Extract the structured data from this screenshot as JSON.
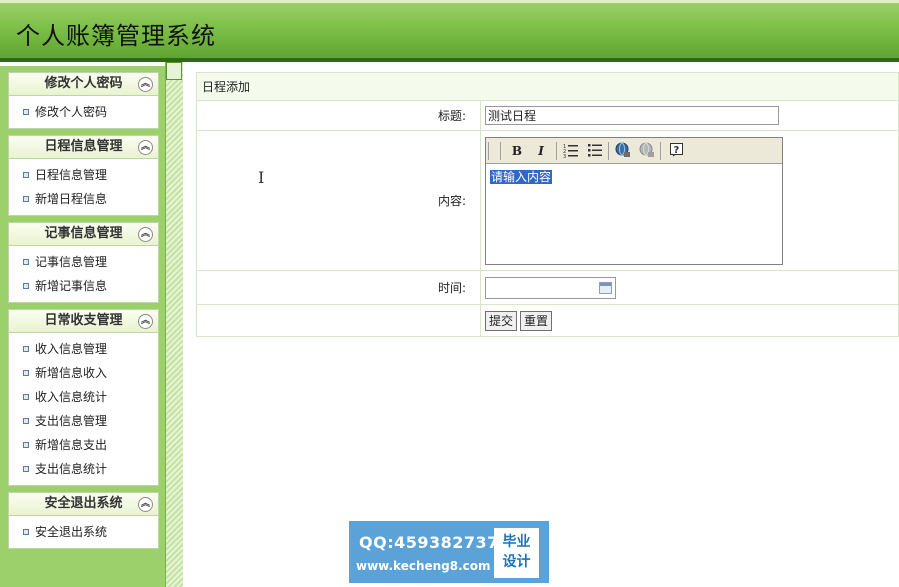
{
  "header": {
    "title": "个人账簿管理系统"
  },
  "sidebar": {
    "groups": [
      {
        "title": "修改个人密码",
        "items": [
          "修改个人密码"
        ]
      },
      {
        "title": "日程信息管理",
        "items": [
          "日程信息管理",
          "新增日程信息"
        ]
      },
      {
        "title": "记事信息管理",
        "items": [
          "记事信息管理",
          "新增记事信息"
        ]
      },
      {
        "title": "日常收支管理",
        "items": [
          "收入信息管理",
          "新增信息收入",
          "收入信息统计",
          "支出信息管理",
          "新增信息支出",
          "支出信息统计"
        ]
      },
      {
        "title": "安全退出系统",
        "items": [
          "安全退出系统"
        ]
      }
    ],
    "collapse_glyph": "︽"
  },
  "form": {
    "caption": "日程添加",
    "title_label": "标题:",
    "title_value": "测试日程",
    "content_label": "内容:",
    "content_text": "请输入内容",
    "time_label": "时间:",
    "time_value": "",
    "submit_label": "提交",
    "reset_label": "重置"
  },
  "editor_toolbar": {
    "bold": "B",
    "italic": "I",
    "icons": [
      "bold-icon",
      "italic-icon",
      "ordered-list-icon",
      "unordered-list-icon",
      "link-icon",
      "unlink-icon",
      "help-icon"
    ]
  },
  "banner": {
    "qq": "QQ:459382737",
    "url": "www.kecheng8.com",
    "badge_line1": "毕业",
    "badge_line2": "设计"
  }
}
